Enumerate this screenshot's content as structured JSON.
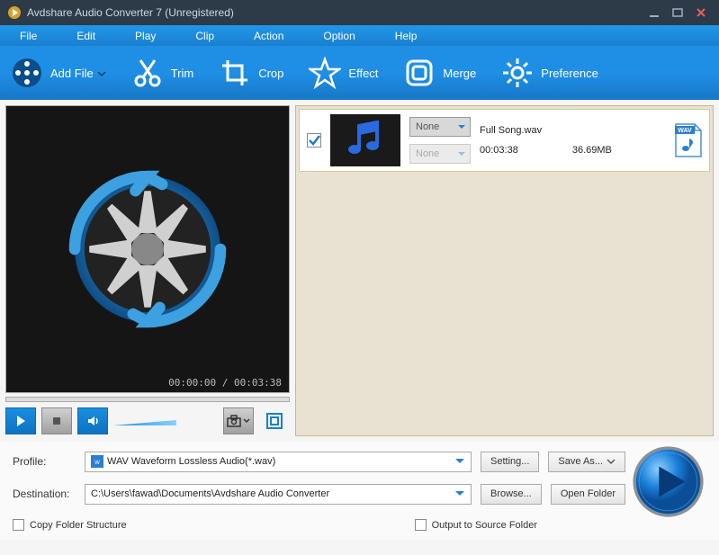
{
  "window": {
    "title": "Avdshare Audio Converter 7 (Unregistered)"
  },
  "menu": {
    "file": "File",
    "edit": "Edit",
    "play": "Play",
    "clip": "Clip",
    "action": "Action",
    "option": "Option",
    "help": "Help"
  },
  "toolbar": {
    "add_file": "Add File",
    "trim": "Trim",
    "crop": "Crop",
    "effect": "Effect",
    "merge": "Merge",
    "preference": "Preference"
  },
  "preview": {
    "timecode": "00:00:00 / 00:03:38"
  },
  "filelist": {
    "item0": {
      "dd1": "None",
      "dd2": "None",
      "name": "Full Song.wav",
      "duration": "00:03:38",
      "size": "36.69MB",
      "format": "WAV"
    }
  },
  "bottom": {
    "profile_label": "Profile:",
    "profile_value": "WAV Waveform Lossless Audio(*.wav)",
    "setting": "Setting...",
    "save_as": "Save As...",
    "destination_label": "Destination:",
    "destination_value": "C:\\Users\\fawad\\Documents\\Avdshare Audio Converter",
    "browse": "Browse...",
    "open_folder": "Open Folder",
    "copy_folder": "Copy Folder Structure",
    "output_source": "Output to Source Folder"
  }
}
